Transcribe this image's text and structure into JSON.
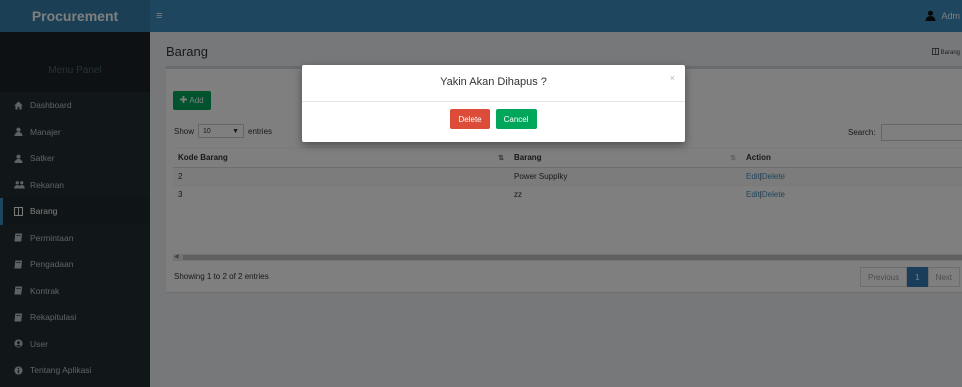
{
  "header": {
    "logo": "Procurement",
    "menu_toggle": "≡",
    "user_name": "Adm"
  },
  "sidebar": {
    "menu_header": "Menu Panel",
    "items": [
      {
        "label": "Dashboard",
        "icon": "home-icon"
      },
      {
        "label": "Manajer",
        "icon": "user-icon"
      },
      {
        "label": "Satker",
        "icon": "user-icon"
      },
      {
        "label": "Rekanan",
        "icon": "users-icon"
      },
      {
        "label": "Barang",
        "icon": "columns-icon",
        "active": true
      },
      {
        "label": "Permintaan",
        "icon": "book-icon"
      },
      {
        "label": "Pengadaan",
        "icon": "book-icon"
      },
      {
        "label": "Kontrak",
        "icon": "book-icon"
      },
      {
        "label": "Rekapitulasi",
        "icon": "book-icon"
      },
      {
        "label": "User",
        "icon": "user-circle-icon"
      },
      {
        "label": "Tentang Aplikasi",
        "icon": "info-icon"
      }
    ]
  },
  "page": {
    "title": "Barang",
    "breadcrumb": "Barang"
  },
  "table_box": {
    "add_label": "Add",
    "show_label": "Show",
    "entries_value": "10",
    "entries_label": "entries",
    "search_label": "Search:",
    "columns": [
      "Kode Barang",
      "Barang",
      "Action"
    ],
    "rows": [
      {
        "kode": "2",
        "barang": "Power Supplky",
        "edit": "Edit",
        "sep": "|",
        "delete": "Delete"
      },
      {
        "kode": "3",
        "barang": "zz",
        "edit": "Edit",
        "sep": "|",
        "delete": "Delete"
      }
    ],
    "info": "Showing 1 to 2 of 2 entries",
    "pager": {
      "previous": "Previous",
      "current": "1",
      "next": "Next"
    }
  },
  "modal": {
    "title": "Yakin Akan Dihapus ?",
    "close": "×",
    "delete_label": "Delete",
    "cancel_label": "Cancel"
  },
  "colors": {
    "header": "#3c8dbc",
    "sidebar": "#222d32",
    "success": "#00a65a",
    "danger": "#dd4b39",
    "primary": "#337ab7"
  }
}
